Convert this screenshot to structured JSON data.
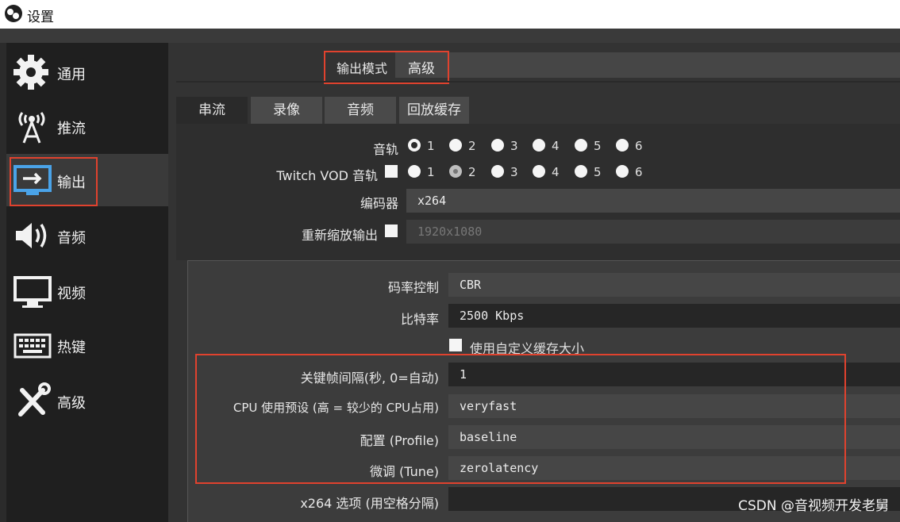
{
  "window": {
    "title": "设置"
  },
  "sidebar": {
    "items": [
      {
        "label": "通用",
        "icon": "gear-icon"
      },
      {
        "label": "推流",
        "icon": "broadcast-tower-icon"
      },
      {
        "label": "输出",
        "icon": "output-monitor-icon"
      },
      {
        "label": "音频",
        "icon": "speaker-icon"
      },
      {
        "label": "视频",
        "icon": "monitor-icon"
      },
      {
        "label": "热键",
        "icon": "keyboard-icon"
      },
      {
        "label": "高级",
        "icon": "tools-icon"
      }
    ],
    "active_index": 2
  },
  "output_mode": {
    "label": "输出模式",
    "value": "高级"
  },
  "tabs": [
    "串流",
    "录像",
    "音频",
    "回放缓存"
  ],
  "active_tab": 0,
  "audio_track": {
    "label": "音轨",
    "options": [
      "1",
      "2",
      "3",
      "4",
      "5",
      "6"
    ]
  },
  "twitch_vod": {
    "label": "Twitch VOD 音轨",
    "options": [
      "1",
      "2",
      "3",
      "4",
      "5",
      "6"
    ]
  },
  "encoder": {
    "label": "编码器",
    "value": "x264"
  },
  "rescale": {
    "label": "重新缩放输出",
    "value": "1920x1080"
  },
  "rate_control": {
    "label": "码率控制",
    "value": "CBR"
  },
  "bitrate": {
    "label": "比特率",
    "value": "2500 Kbps"
  },
  "custom_buffer": {
    "label": "使用自定义缓存大小"
  },
  "keyframe": {
    "label": "关键帧间隔(秒, 0=自动)",
    "value": "1"
  },
  "cpu_preset": {
    "label": "CPU 使用预设 (高 = 较少的 CPU占用)",
    "value": "veryfast"
  },
  "profile": {
    "label": "配置 (Profile)",
    "value": "baseline"
  },
  "tune": {
    "label": "微调 (Tune)",
    "value": "zerolatency"
  },
  "x264_opts": {
    "label": "x264 选项 (用空格分隔)",
    "value": ""
  },
  "watermark": "CSDN @音视频开发老舅",
  "colors": {
    "highlight": "#e0422e",
    "background": "#2b2b2b"
  }
}
